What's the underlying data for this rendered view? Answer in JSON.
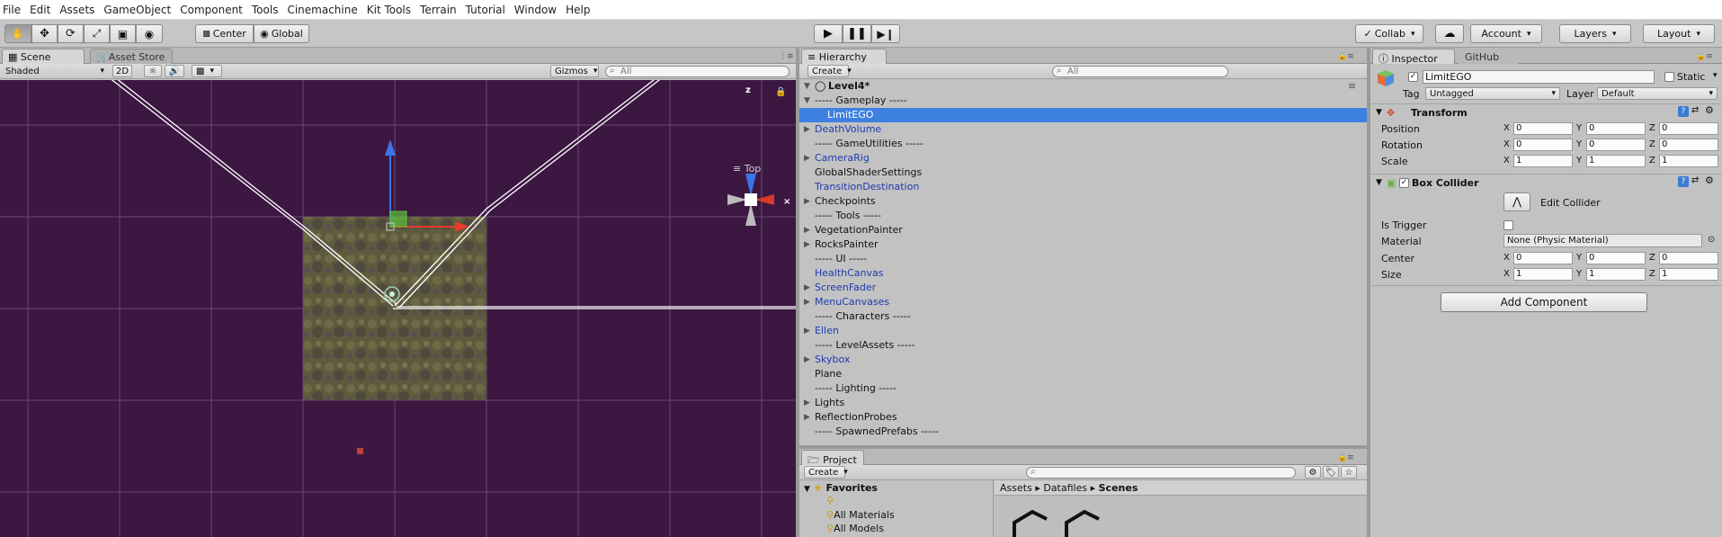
{
  "menu": [
    "File",
    "Edit",
    "Assets",
    "GameObject",
    "Component",
    "Tools",
    "Cinemachine",
    "Kit Tools",
    "Terrain",
    "Tutorial",
    "Window",
    "Help"
  ],
  "toolbar": {
    "pivot": "Center",
    "space": "Global",
    "collab": "Collab",
    "account": "Account",
    "layers": "Layers",
    "layout": "Layout"
  },
  "scene": {
    "tabs": [
      "Scene",
      "Asset Store"
    ],
    "shading": "Shaded",
    "mode2d": "2D",
    "gizmos": "Gizmos",
    "search_placeholder": "All",
    "gizmo_axis_label": "z",
    "view_label": "Top"
  },
  "hierarchy": {
    "tab": "Hierarchy",
    "create": "Create",
    "search_placeholder": "All",
    "scene_name": "Level4*",
    "items": [
      {
        "label": "----- Gameplay -----",
        "indent": 1,
        "arrow": "open",
        "prefab": false,
        "selected": false
      },
      {
        "label": "LimitEGO",
        "indent": 2,
        "arrow": "",
        "prefab": false,
        "selected": true
      },
      {
        "label": "DeathVolume",
        "indent": 1,
        "arrow": "closed",
        "prefab": true,
        "selected": false
      },
      {
        "label": "----- GameUtilities -----",
        "indent": 1,
        "arrow": "",
        "prefab": false,
        "selected": false
      },
      {
        "label": "CameraRig",
        "indent": 1,
        "arrow": "closed",
        "prefab": true,
        "selected": false
      },
      {
        "label": "GlobalShaderSettings",
        "indent": 1,
        "arrow": "",
        "prefab": false,
        "selected": false
      },
      {
        "label": "TransitionDestination",
        "indent": 1,
        "arrow": "",
        "prefab": true,
        "selected": false
      },
      {
        "label": "Checkpoints",
        "indent": 1,
        "arrow": "closed",
        "prefab": false,
        "selected": false
      },
      {
        "label": "----- Tools -----",
        "indent": 1,
        "arrow": "",
        "prefab": false,
        "selected": false
      },
      {
        "label": "VegetationPainter",
        "indent": 1,
        "arrow": "closed",
        "prefab": false,
        "selected": false
      },
      {
        "label": "RocksPainter",
        "indent": 1,
        "arrow": "closed",
        "prefab": false,
        "selected": false
      },
      {
        "label": "----- UI -----",
        "indent": 1,
        "arrow": "",
        "prefab": false,
        "selected": false
      },
      {
        "label": "HealthCanvas",
        "indent": 1,
        "arrow": "",
        "prefab": true,
        "selected": false
      },
      {
        "label": "ScreenFader",
        "indent": 1,
        "arrow": "closed",
        "prefab": true,
        "selected": false
      },
      {
        "label": "MenuCanvases",
        "indent": 1,
        "arrow": "closed",
        "prefab": true,
        "selected": false
      },
      {
        "label": "----- Characters -----",
        "indent": 1,
        "arrow": "",
        "prefab": false,
        "selected": false
      },
      {
        "label": "Ellen",
        "indent": 1,
        "arrow": "closed",
        "prefab": true,
        "selected": false
      },
      {
        "label": "----- LevelAssets -----",
        "indent": 1,
        "arrow": "",
        "prefab": false,
        "selected": false
      },
      {
        "label": "Skybox",
        "indent": 1,
        "arrow": "closed",
        "prefab": true,
        "selected": false
      },
      {
        "label": "Plane",
        "indent": 1,
        "arrow": "",
        "prefab": false,
        "selected": false
      },
      {
        "label": "----- Lighting -----",
        "indent": 1,
        "arrow": "",
        "prefab": false,
        "selected": false
      },
      {
        "label": "Lights",
        "indent": 1,
        "arrow": "closed",
        "prefab": false,
        "selected": false
      },
      {
        "label": "ReflectionProbes",
        "indent": 1,
        "arrow": "closed",
        "prefab": false,
        "selected": false
      },
      {
        "label": "----- SpawnedPrefabs -----",
        "indent": 1,
        "arrow": "",
        "prefab": false,
        "selected": false
      }
    ]
  },
  "project": {
    "tab": "Project",
    "create": "Create",
    "favorites": "Favorites",
    "favorite_items": [
      "All Materials",
      "All Models"
    ],
    "breadcrumb": [
      "Assets",
      "Datafiles",
      "Scenes"
    ]
  },
  "inspector": {
    "tabs": [
      "Inspector",
      "GitHub"
    ],
    "object_name": "LimitEGO",
    "static_label": "Static",
    "tag_label": "Tag",
    "tag_value": "Untagged",
    "layer_label": "Layer",
    "layer_value": "Default",
    "transform": {
      "title": "Transform",
      "rows": [
        {
          "label": "Position",
          "x": "0",
          "y": "0",
          "z": "0"
        },
        {
          "label": "Rotation",
          "x": "0",
          "y": "0",
          "z": "0"
        },
        {
          "label": "Scale",
          "x": "1",
          "y": "1",
          "z": "1"
        }
      ]
    },
    "box_collider": {
      "title": "Box Collider",
      "edit_collider": "Edit Collider",
      "is_trigger_label": "Is Trigger",
      "material_label": "Material",
      "material_value": "None (Physic Material)",
      "center": {
        "label": "Center",
        "x": "0",
        "y": "0",
        "z": "0"
      },
      "size": {
        "label": "Size",
        "x": "1",
        "y": "1",
        "z": "1"
      }
    },
    "add_component": "Add Component"
  },
  "axis_letters": {
    "x": "X",
    "y": "Y",
    "z": "Z"
  }
}
